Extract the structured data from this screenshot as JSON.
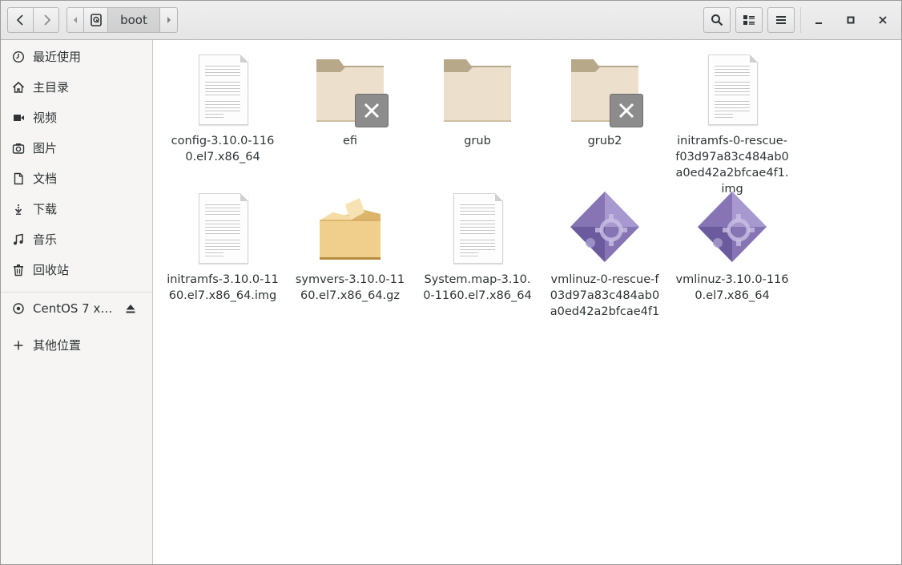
{
  "header": {
    "path": [
      "boot"
    ],
    "search_icon": "search-icon",
    "view_icon": "list-view-icon",
    "menu_icon": "hamburger-menu-icon"
  },
  "sidebar": {
    "items": [
      {
        "label": "最近使用",
        "icon": "recent-clock-icon"
      },
      {
        "label": "主目录",
        "icon": "home-icon"
      },
      {
        "label": "视频",
        "icon": "video-icon"
      },
      {
        "label": "图片",
        "icon": "camera-icon"
      },
      {
        "label": "文档",
        "icon": "document-icon"
      },
      {
        "label": "下载",
        "icon": "download-icon"
      },
      {
        "label": "音乐",
        "icon": "music-icon"
      },
      {
        "label": "回收站",
        "icon": "trash-icon"
      }
    ],
    "device": {
      "label": "CentOS 7 x…",
      "icon": "disc-icon",
      "eject_icon": "eject-icon"
    },
    "other": {
      "label": "其他位置",
      "icon": "plus-icon"
    }
  },
  "files": [
    {
      "name": "config-3.10.0-1160.el7.x86_64",
      "type": "text"
    },
    {
      "name": "efi",
      "type": "folder-locked"
    },
    {
      "name": "grub",
      "type": "folder"
    },
    {
      "name": "grub2",
      "type": "folder-locked"
    },
    {
      "name": "initramfs-0-rescue-f03d97a83c484ab0a0ed42a2bfcae4f1.img",
      "type": "text"
    },
    {
      "name": "initramfs-3.10.0-1160.el7.x86_64.img",
      "type": "text"
    },
    {
      "name": "symvers-3.10.0-1160.el7.x86_64.gz",
      "type": "archive"
    },
    {
      "name": "System.map-3.10.0-1160.el7.x86_64",
      "type": "text"
    },
    {
      "name": "vmlinuz-0-rescue-f03d97a83c484ab0a0ed42a2bfcae4f1",
      "type": "executable"
    },
    {
      "name": "vmlinuz-3.10.0-1160.el7.x86_64",
      "type": "executable"
    }
  ]
}
